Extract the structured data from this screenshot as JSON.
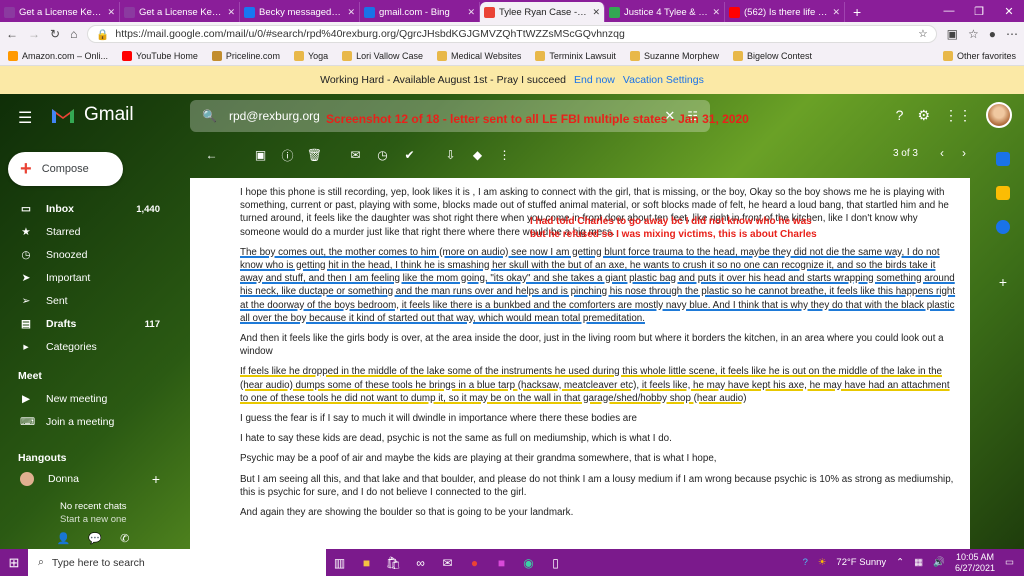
{
  "browser": {
    "tabs": [
      {
        "label": "Get a License Key - De",
        "color": "#8b3aa0"
      },
      {
        "label": "Get a License Key - De",
        "color": "#8b3aa0"
      },
      {
        "label": "Becky messaged your",
        "color": "#1877f2"
      },
      {
        "label": "gmail.com - Bing",
        "color": "#1a73e8"
      },
      {
        "label": "Tylee Ryan Case - Lori",
        "color": "#ea4335"
      },
      {
        "label": "Justice 4 Tylee & JJ - L",
        "color": "#34a853"
      },
      {
        "label": "(562) Is there life after",
        "color": "#ff0000"
      }
    ],
    "url": "https://mail.google.com/mail/u/0/#search/rpd%40rexburg.org/QgrcJHsbdKGJGMVZQhTtWZZsMScGQvhnzqg",
    "bookmarks": [
      "Amazon.com – Onli...",
      "YouTube Home",
      "Priceline.com",
      "Yoga",
      "Lori Vallow Case",
      "Medical Websites",
      "Terminix Lawsuit",
      "Suzanne Morphew",
      "Bigelow Contest"
    ],
    "other_favorites": "Other favorites"
  },
  "banner": {
    "text": "Working Hard - Available August 1st - Pray I succeed",
    "end_now": "End now",
    "vacation": "Vacation Settings"
  },
  "gmail": {
    "logo_text": "Gmail",
    "search_value": "rpd@rexburg.org",
    "overlay_note": "Screenshot 12 of 18 - letter sent to all LE FBI multiple states - Jan 31, 2020",
    "compose": "Compose",
    "nav": [
      {
        "label": "Inbox",
        "count": "1,440",
        "icon": "inbox-icon"
      },
      {
        "label": "Starred",
        "count": "",
        "icon": "star-icon"
      },
      {
        "label": "Snoozed",
        "count": "",
        "icon": "clock-icon"
      },
      {
        "label": "Important",
        "count": "",
        "icon": "important-icon"
      },
      {
        "label": "Sent",
        "count": "",
        "icon": "send-icon"
      },
      {
        "label": "Drafts",
        "count": "117",
        "icon": "draft-icon"
      },
      {
        "label": "Categories",
        "count": "",
        "icon": "label-icon"
      }
    ],
    "meet": {
      "heading": "Meet",
      "new_meeting": "New meeting",
      "join_meeting": "Join a meeting"
    },
    "hangouts": {
      "heading": "Hangouts",
      "user": "Donna",
      "no_chats": "No recent chats",
      "start": "Start a new one"
    },
    "pager": "3 of 3"
  },
  "email": {
    "p1": "I hope this phone is still recording, yep, look likes it is ,  I am asking to connect with the girl, that is missing, or the boy, Okay so the boy shows me he is playing with something, current or past, playing with some, blocks made out of stuffed animal material, or soft blocks made of felt, he heard a loud bang, that startled him and he turned around, it feels like the daughter was shot right there when you come in front door about ten feet, like right in front of the kitchen, like I don't know why someone would do a murder just like that right there where there would be a big mess.",
    "handnote": "I had told Charles to go away bc I did not know who he was\nbut he refused so I was mixing victims, this is about Charles",
    "p2": "The boy comes out, the mother comes to him (more on audio) see now I am getting blunt force trauma to the head, maybe they did not die the same way, I do not know who is getting hit in the head, I think he is smashing her skull with the but of an axe, he wants to crush it so no one can recognize it, and so the birds take it away and stuff, and then I am feeling like the mom going, \"its okay\" and she takes a giant plastic bag and puts it over his head and starts wrapping something around his neck, like ductape or something and the man runs over and helps and is pinching his nose through the plastic so he cannot breathe, it feels like this happens right at the doorway of the boys bedroom, it feels like there is a bunkbed and the comforters are mostly navy blue.  And I think that is why they do that with the black plastic  all over the boy because it kind of started out that way, which would mean total premeditation.",
    "p3": "And then it feels like the girls body is over, at the area inside the door, just in the living room but where it borders the kitchen, in an area where you could look out a window",
    "p4": "If feels like he dropped in the middle of the lake some of the instruments he used during this whole little scene, it feels like he is out on the middle of the lake in the (hear audio) dumps some of these tools he brings in a blue tarp (hacksaw, meatcleaver etc), it feels like, he may have kept his axe, he may have had an attachment to one of these tools he did not want to dump it, so it may be on the wall in that garage/shed/hobby shop (hear audio)",
    "p5": "I guess the fear is if I say to much it will dwindle in importance where there these bodies are",
    "p6": "I hate to say these kids are dead, psychic is not the same as full on mediumship, which is what I do.",
    "p7": "Psychic may be a poof of air and maybe the kids are playing at their grandma somewhere, that is what I hope,",
    "p8": "But I am seeing all this, and that lake and that boulder, and please do not think I am a lousy medium if I am wrong because psychic is 10% as strong as mediumship, this is psychic for sure, and I do not believe I connected to the girl.",
    "p9": "And again they are showing the boulder so that is going to be your landmark."
  },
  "taskbar": {
    "search_placeholder": "Type here to search",
    "weather": "72°F  Sunny",
    "time": "10:05 AM",
    "date": "6/27/2021"
  }
}
